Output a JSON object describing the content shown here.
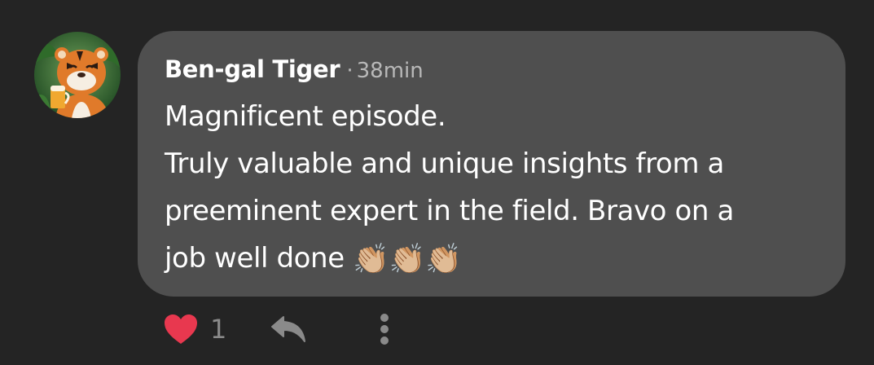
{
  "comment": {
    "author": "Ben-gal Tiger",
    "separator": "·",
    "time": "38min",
    "lines": [
      "Magnificent episode.",
      "Truly valuable and unique insights from a",
      "preeminent expert in the field. Bravo on a",
      "job well done"
    ],
    "emoji": "👏🏼👏🏼👏🏼",
    "avatar_icon": "tiger-avatar-icon"
  },
  "actions": {
    "like_count": "1",
    "like_icon": "heart-icon",
    "reply_icon": "reply-icon",
    "more_icon": "more-vertical-icon"
  },
  "colors": {
    "background": "#242424",
    "bubble": "#4f4f4f",
    "heart": "#e8384f",
    "muted": "#8a8a8a"
  }
}
